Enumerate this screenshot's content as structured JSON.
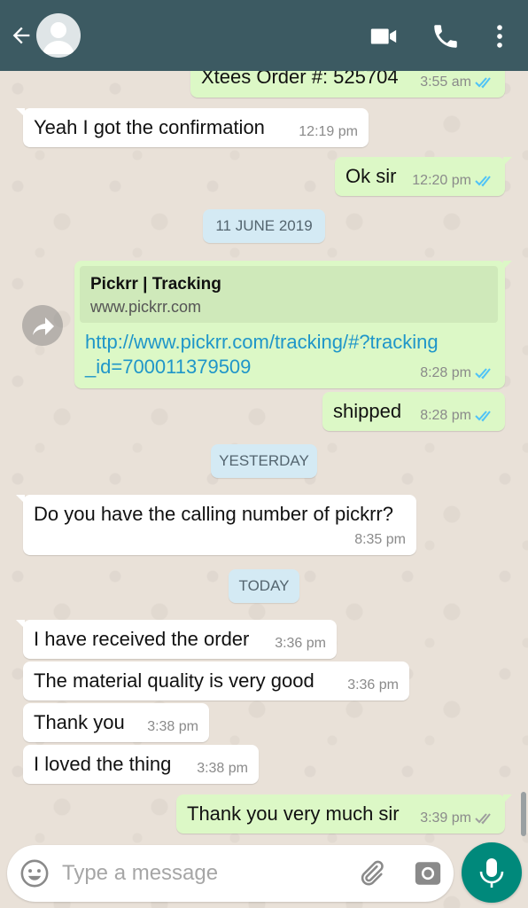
{
  "header": {
    "back_icon": "arrow-left-icon",
    "avatar_icon": "default-avatar-icon",
    "video_icon": "video-camera-icon",
    "call_icon": "phone-icon",
    "menu_icon": "more-vertical-icon"
  },
  "messages": [
    {
      "dir": "out",
      "text": "Xtees Order #: 525704",
      "time": "3:55 am",
      "status": "read"
    },
    {
      "dir": "in",
      "text": "Yeah I got the confirmation",
      "time": "12:19 pm"
    },
    {
      "dir": "out",
      "text": "Ok sir",
      "time": "12:20 pm",
      "status": "read"
    },
    {
      "type": "date",
      "text": "11 JUNE 2019"
    },
    {
      "dir": "out",
      "type": "link",
      "preview_title": "Pickrr | Tracking",
      "preview_site": "www.pickrr.com",
      "link_line1": "http://www.pickrr.com/tracking/#?tracking",
      "link_line2": "_id=700011379509",
      "time": "8:28 pm",
      "status": "read"
    },
    {
      "dir": "out",
      "text": "shipped",
      "time": "8:28 pm",
      "status": "read"
    },
    {
      "type": "date",
      "text": "YESTERDAY"
    },
    {
      "dir": "in",
      "text": "Do you have the calling number of pickrr?",
      "time": "8:35 pm"
    },
    {
      "type": "date",
      "text": "TODAY"
    },
    {
      "dir": "in",
      "text": "I have received the order",
      "time": "3:36 pm"
    },
    {
      "dir": "in",
      "text": "The material quality is very good",
      "time": "3:36 pm"
    },
    {
      "dir": "in",
      "text": "Thank you",
      "time": "3:38 pm"
    },
    {
      "dir": "in",
      "text": "I loved the thing",
      "time": "3:38 pm"
    },
    {
      "dir": "out",
      "text": "Thank you very much sir",
      "time": "3:39 pm",
      "status": "delivered"
    }
  ],
  "composer": {
    "placeholder": "Type a message",
    "emoji_icon": "emoji-icon",
    "attach_icon": "paperclip-icon",
    "camera_icon": "camera-icon",
    "mic_icon": "microphone-icon"
  },
  "colors": {
    "header": "#3c5a62",
    "outgoing": "#dcf8c6",
    "incoming": "#ffffff",
    "read_tick": "#4fc3f7",
    "send_button": "#00897b"
  }
}
